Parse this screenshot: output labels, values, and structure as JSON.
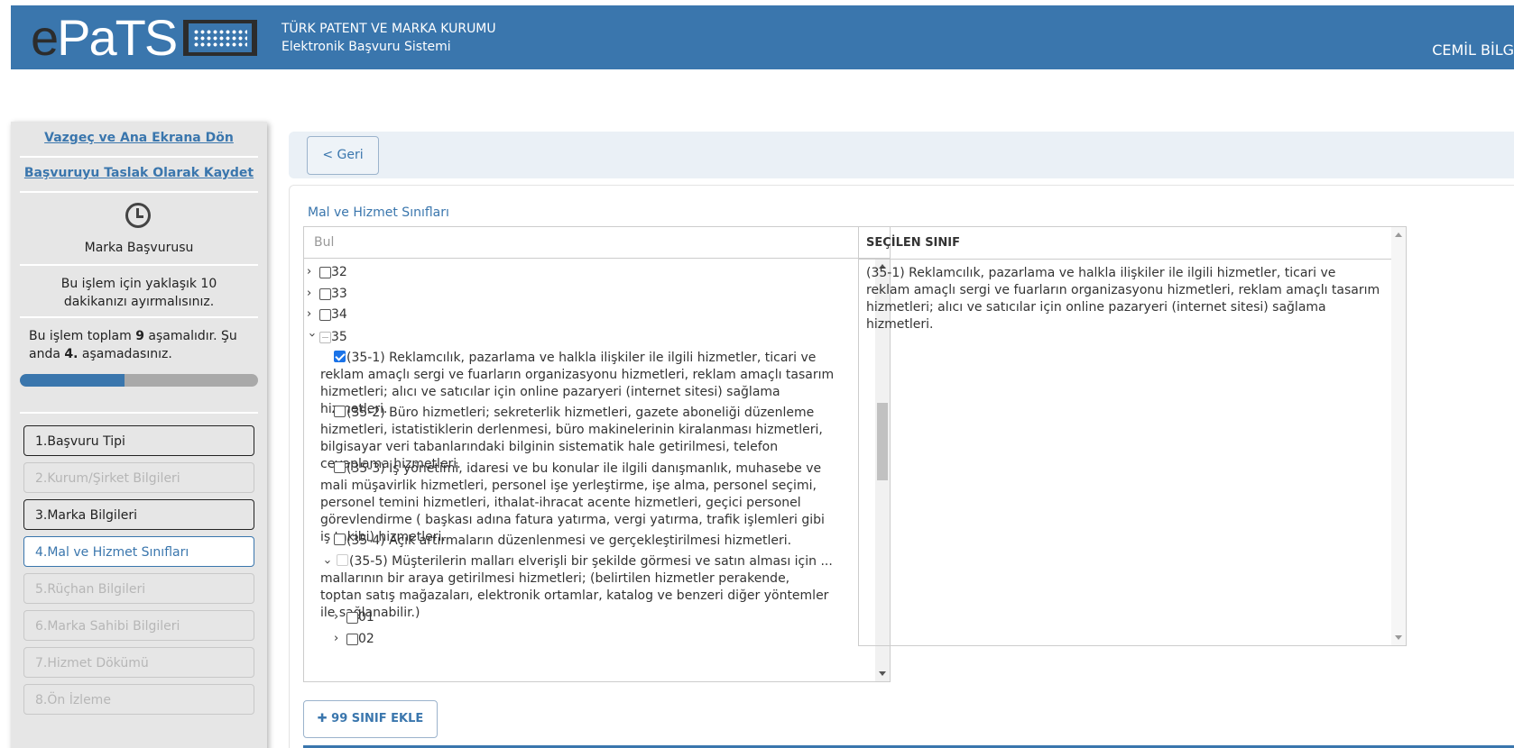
{
  "header": {
    "logo_e": "e",
    "logo_pats": "PaTS",
    "org_line1": "TÜRK PATENT VE MARKA KURUMU",
    "org_line2": "Elektronik Başvuru Sistemi",
    "user": "CEMİL BİLG"
  },
  "sidebar": {
    "cancel_link": "Vazgeç ve Ana Ekrana Dön",
    "draft_link": "Başvuruyu Taslak Olarak Kaydet",
    "app_type": "Marka Başvurusu",
    "time_note": "Bu işlem için yaklaşık 10 dakikanızı ayırmalısınız.",
    "stage_prefix": "Bu işlem toplam ",
    "stage_total": "9",
    "stage_mid": " aşamalıdır. Şu anda ",
    "stage_current": "4.",
    "stage_suffix": " aşamadasınız.",
    "progress_fraction": 0.44,
    "steps": [
      {
        "label": "1.Başvuru Tipi",
        "state": "done"
      },
      {
        "label": "2.Kurum/Şirket Bilgileri",
        "state": "disabled"
      },
      {
        "label": "3.Marka Bilgileri",
        "state": "done"
      },
      {
        "label": "4.Mal ve Hizmet Sınıfları",
        "state": "active"
      },
      {
        "label": "5.Rüçhan Bilgileri",
        "state": "disabled"
      },
      {
        "label": "6.Marka Sahibi Bilgileri",
        "state": "disabled"
      },
      {
        "label": "7.Hizmet Dökümü",
        "state": "disabled"
      },
      {
        "label": "8.Ön İzleme",
        "state": "disabled"
      }
    ]
  },
  "main": {
    "back_button": "< Geri",
    "section_title": "Mal ve Hizmet Sınıfları",
    "search_placeholder": "Bul",
    "tree": {
      "c32": "32",
      "c33": "33",
      "c34": "34",
      "c35": "35",
      "i35_1": "(35-1) Reklamcılık, pazarlama ve halkla ilişkiler ile ilgili hizmetler, ticari ve reklam amaçlı sergi ve fuarların organizasyonu hizmetleri, reklam amaçlı tasarım hizmetleri; alıcı ve satıcılar için online pazaryeri (internet sitesi) sağlama hizmetleri.",
      "i35_2": "(35-2) Büro hizmetleri; sekreterlik hizmetleri, gazete aboneliği düzenleme hizmetleri, istatistiklerin derlenmesi, büro makinelerinin kiralanması hizmetleri, bilgisayar veri tabanlarındaki bilginin sistematik hale getirilmesi, telefon cevaplama hizmetleri.",
      "i35_3": "(35-3) İş yönetimi, idaresi ve bu konular ile ilgili danışmanlık, muhasebe ve mali müşavirlik hizmetleri, personel işe yerleştirme, işe alma, personel seçimi, personel temini hizmetleri, ithalat-ihracat acente hizmetleri, geçici personel görevlendirme ( başkası adına fatura yatırma, vergi yatırma, trafik işlemleri gibi iş takibi) hizmetleri.",
      "i35_4": "(35-4) Açık artırmaların düzenlenmesi ve gerçekleştirilmesi hizmetleri.",
      "i35_5": "(35-5) Müşterilerin malları elverişli bir şekilde görmesi ve satın alması için ... mallarının bir araya getirilmesi hizmetleri; (belirtilen hizmetler perakende, toptan satış mağazaları, elektronik ortamlar, katalog ve benzeri diğer yöntemler ile sağlanabilir.)",
      "s01": "01",
      "s02": "02"
    },
    "selected_header": "SEÇİLEN SINIF",
    "selected_text": "(35-1) Reklamcılık, pazarlama ve halkla ilişkiler ile ilgili hizmetler, ticari ve reklam amaçlı sergi ve fuarların organizasyonu hizmetleri, reklam amaçlı tasarım hizmetleri; alıcı ve satıcılar için online pazaryeri (internet sitesi) sağlama hizmetleri.",
    "add_button": "99 SINIF EKLE"
  }
}
